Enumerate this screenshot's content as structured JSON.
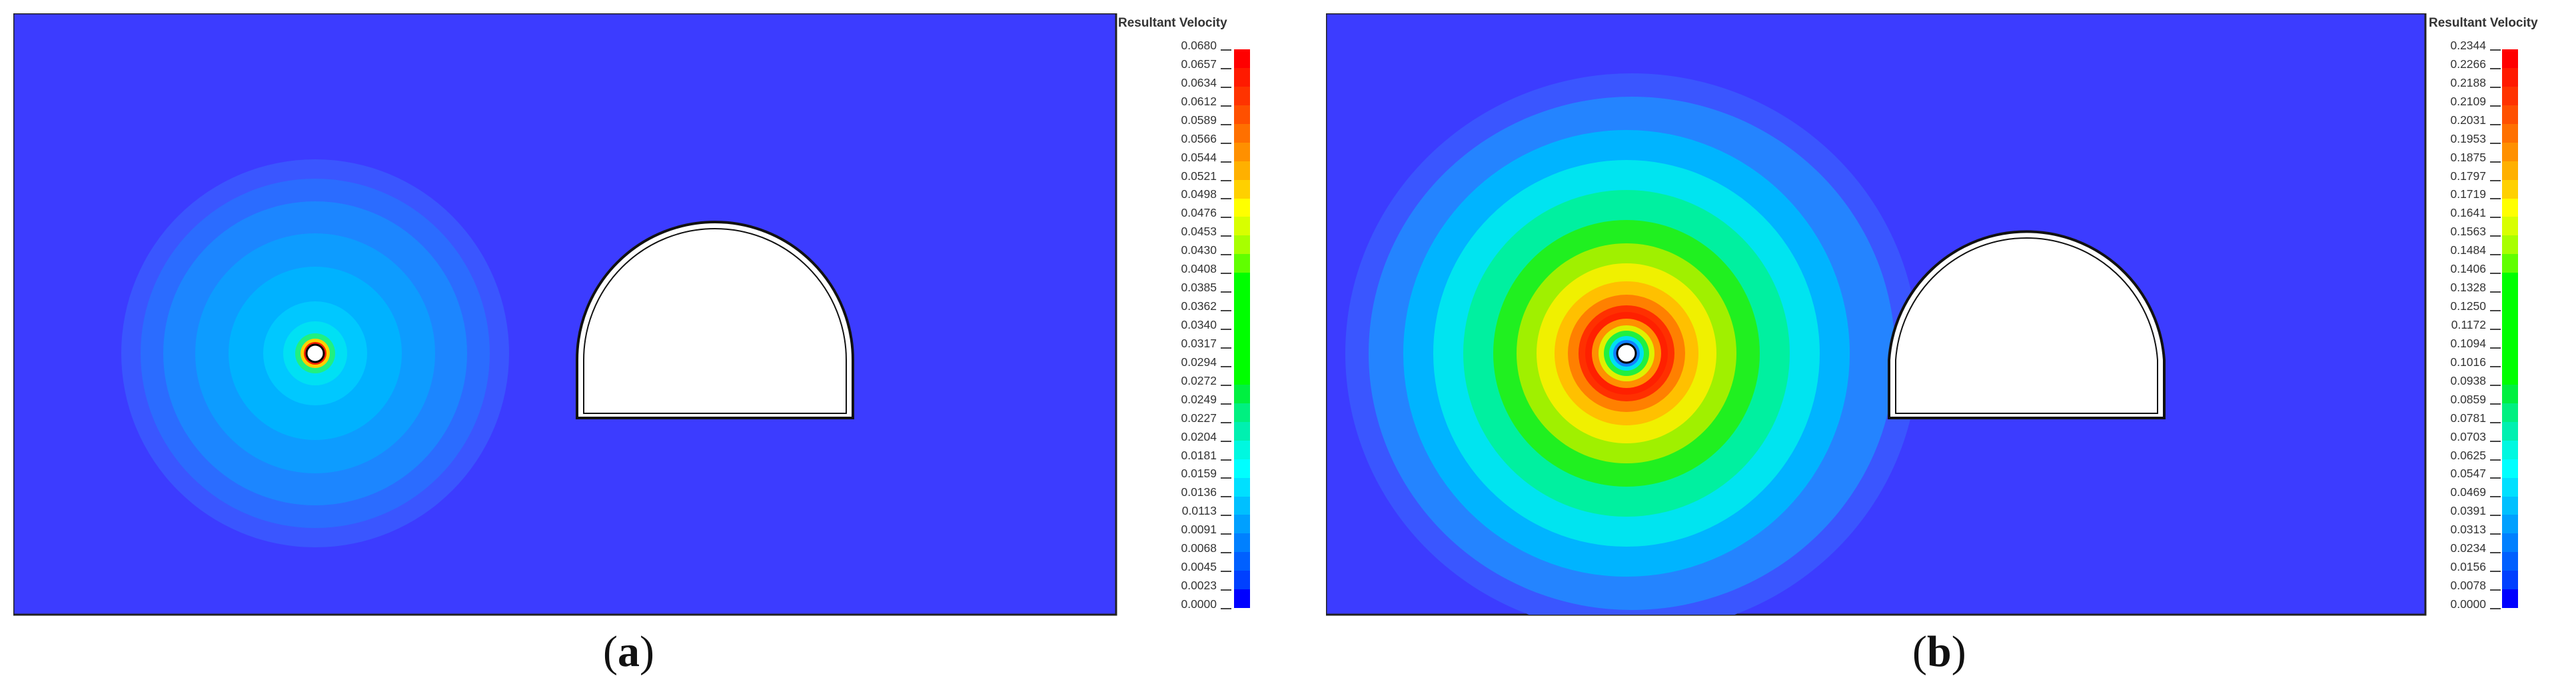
{
  "chart_data": [
    {
      "type": "heatmap",
      "panel": "a",
      "caption_open": "(",
      "caption_letter": "a",
      "caption_close": ")",
      "legend_title": "Resultant Velocity",
      "range": [
        0.0,
        0.068
      ],
      "ticks": [
        "0.0680",
        "0.0657",
        "0.0634",
        "0.0612",
        "0.0589",
        "0.0566",
        "0.0544",
        "0.0521",
        "0.0498",
        "0.0476",
        "0.0453",
        "0.0430",
        "0.0408",
        "0.0385",
        "0.0362",
        "0.0340",
        "0.0317",
        "0.0294",
        "0.0272",
        "0.0249",
        "0.0227",
        "0.0204",
        "0.0181",
        "0.0159",
        "0.0136",
        "0.0113",
        "0.0091",
        "0.0068",
        "0.0045",
        "0.0023",
        "0.0000"
      ],
      "contour_colors": [
        "#3a56ff",
        "#2b6cff",
        "#1c86ff",
        "#0d9cff",
        "#00b2ff",
        "#00c8ff",
        "#00e0f4",
        "#20f080",
        "#ffd000",
        "#ff2000"
      ]
    },
    {
      "type": "heatmap",
      "panel": "b",
      "caption_open": "(",
      "caption_letter": "b",
      "caption_close": ")",
      "legend_title": "Resultant Velocity",
      "range": [
        0.0,
        0.2344
      ],
      "ticks": [
        "0.2344",
        "0.2266",
        "0.2188",
        "0.2109",
        "0.2031",
        "0.1953",
        "0.1875",
        "0.1797",
        "0.1719",
        "0.1641",
        "0.1563",
        "0.1484",
        "0.1406",
        "0.1328",
        "0.1250",
        "0.1172",
        "0.1094",
        "0.1016",
        "0.0938",
        "0.0859",
        "0.0781",
        "0.0703",
        "0.0625",
        "0.0547",
        "0.0469",
        "0.0391",
        "0.0313",
        "0.0234",
        "0.0156",
        "0.0078",
        "0.0000"
      ],
      "contour_colors": [
        "#3a56ff",
        "#2484ff",
        "#00b4ff",
        "#00e4f0",
        "#00f0a0",
        "#20f020",
        "#a0f000",
        "#f0f000",
        "#ffc000",
        "#ff8000",
        "#ff3000",
        "#ff2000",
        "#ff9000",
        "#e0f000",
        "#20f040",
        "#00e0f0",
        "#1080ff"
      ]
    }
  ],
  "colors": {
    "background": "#3c3cff",
    "colormap": [
      "#ff0000",
      "#ff1a00",
      "#ff3300",
      "#ff5000",
      "#ff7000",
      "#ff9000",
      "#ffb000",
      "#ffd000",
      "#ffff00",
      "#d8ff00",
      "#a8ff00",
      "#60ff00",
      "#00ff00",
      "#00ff00",
      "#00ff00",
      "#00ff00",
      "#00ff00",
      "#00ff00",
      "#00f040",
      "#00f080",
      "#00f0b0",
      "#00f8e0",
      "#00ffff",
      "#00e0ff",
      "#00c0ff",
      "#00a0ff",
      "#0080ff",
      "#0060ff",
      "#0040ff",
      "#0000ff"
    ]
  }
}
